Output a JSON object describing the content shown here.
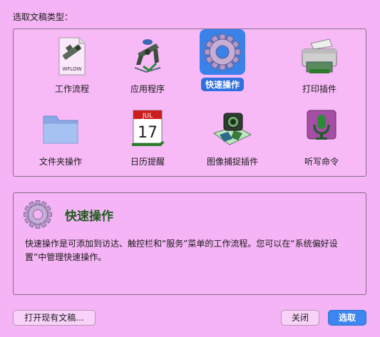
{
  "heading": "选取文稿类型：",
  "tiles": [
    {
      "label": "工作流程",
      "icon": "workflow-icon",
      "badge": "WFLOW"
    },
    {
      "label": "应用程序",
      "icon": "application-icon"
    },
    {
      "label": "快速操作",
      "icon": "gear-icon",
      "selected": true
    },
    {
      "label": "打印插件",
      "icon": "printer-icon"
    },
    {
      "label": "文件夹操作",
      "icon": "folder-icon"
    },
    {
      "label": "日历提醒",
      "icon": "calendar-icon",
      "month": "JUL",
      "day": "17"
    },
    {
      "label": "图像捕捉插件",
      "icon": "image-capture-icon"
    },
    {
      "label": "听写命令",
      "icon": "microphone-icon"
    }
  ],
  "description": {
    "title": "快速操作",
    "text": "快速操作是可添加到访达、触控栏和“服务”菜单的工作流程。您可以在“系统偏好设置”中管理快速操作。"
  },
  "buttons": {
    "open_existing": "打开现有文稿...",
    "close": "关闭",
    "choose": "选取"
  },
  "colors": {
    "selection": "#2f6fe0",
    "background": "#f5b4f5"
  }
}
